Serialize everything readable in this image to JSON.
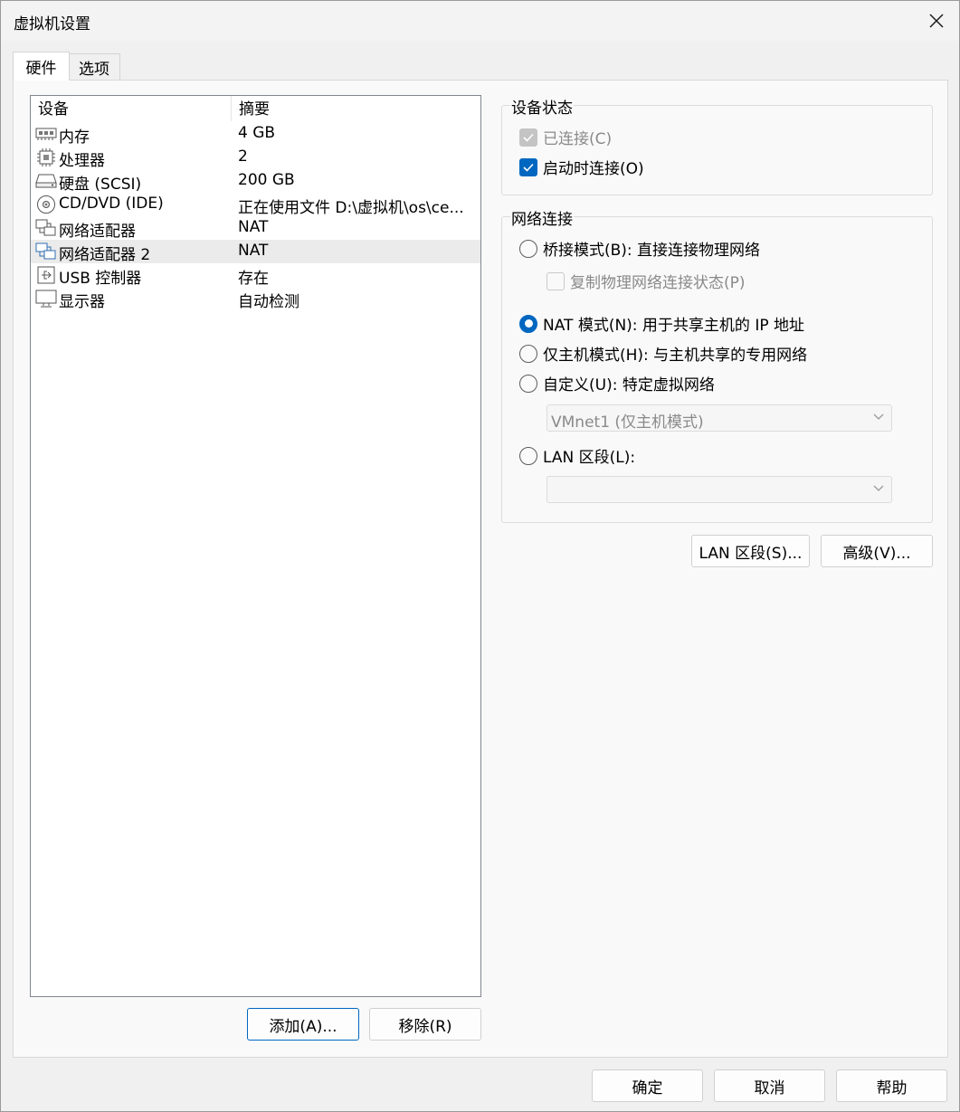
{
  "window": {
    "title": "虚拟机设置",
    "close_icon": "close-icon"
  },
  "tabs": [
    {
      "label": "硬件",
      "active": true
    },
    {
      "label": "选项",
      "active": false
    }
  ],
  "device_list": {
    "columns": [
      "设备",
      "摘要"
    ],
    "rows": [
      {
        "icon": "memory-icon",
        "name": "内存",
        "summary": "4 GB",
        "selected": false
      },
      {
        "icon": "processor-icon",
        "name": "处理器",
        "summary": "2",
        "selected": false
      },
      {
        "icon": "hard-disk-icon",
        "name": "硬盘 (SCSI)",
        "summary": "200 GB",
        "selected": false
      },
      {
        "icon": "cd-dvd-icon",
        "name": "CD/DVD (IDE)",
        "summary": "正在使用文件 D:\\虚拟机\\os\\ce...",
        "selected": false
      },
      {
        "icon": "network-adapter-icon",
        "name": "网络适配器",
        "summary": "NAT",
        "selected": false
      },
      {
        "icon": "network-adapter-icon",
        "name": "网络适配器 2",
        "summary": "NAT",
        "selected": true
      },
      {
        "icon": "usb-icon",
        "name": "USB 控制器",
        "summary": "存在",
        "selected": false
      },
      {
        "icon": "display-icon",
        "name": "显示器",
        "summary": "自动检测",
        "selected": false
      }
    ]
  },
  "list_buttons": {
    "add": "添加(A)...",
    "remove": "移除(R)"
  },
  "device_status": {
    "title": "设备状态",
    "connected": {
      "label": "已连接(C)",
      "checked": true,
      "enabled": false
    },
    "connect_at_power_on": {
      "label": "启动时连接(O)",
      "checked": true,
      "enabled": true
    }
  },
  "network_connection": {
    "title": "网络连接",
    "bridged": {
      "label": "桥接模式(B): 直接连接物理网络",
      "checked": false
    },
    "replicate": {
      "label": "复制物理网络连接状态(P)",
      "checked": false,
      "enabled": false
    },
    "nat": {
      "label": "NAT 模式(N): 用于共享主机的 IP 地址",
      "checked": true
    },
    "host_only": {
      "label": "仅主机模式(H): 与主机共享的专用网络",
      "checked": false
    },
    "custom": {
      "label": "自定义(U): 特定虚拟网络",
      "checked": false
    },
    "custom_select": "VMnet1 (仅主机模式)",
    "lan_segment": {
      "label": "LAN 区段(L):",
      "checked": false
    },
    "lan_select": ""
  },
  "network_buttons": {
    "lan_segments": "LAN 区段(S)...",
    "advanced": "高级(V)..."
  },
  "footer_buttons": {
    "ok": "确定",
    "cancel": "取消",
    "help": "帮助"
  },
  "colors": {
    "accent": "#0067c0",
    "selected_row": "#ebebeb"
  }
}
